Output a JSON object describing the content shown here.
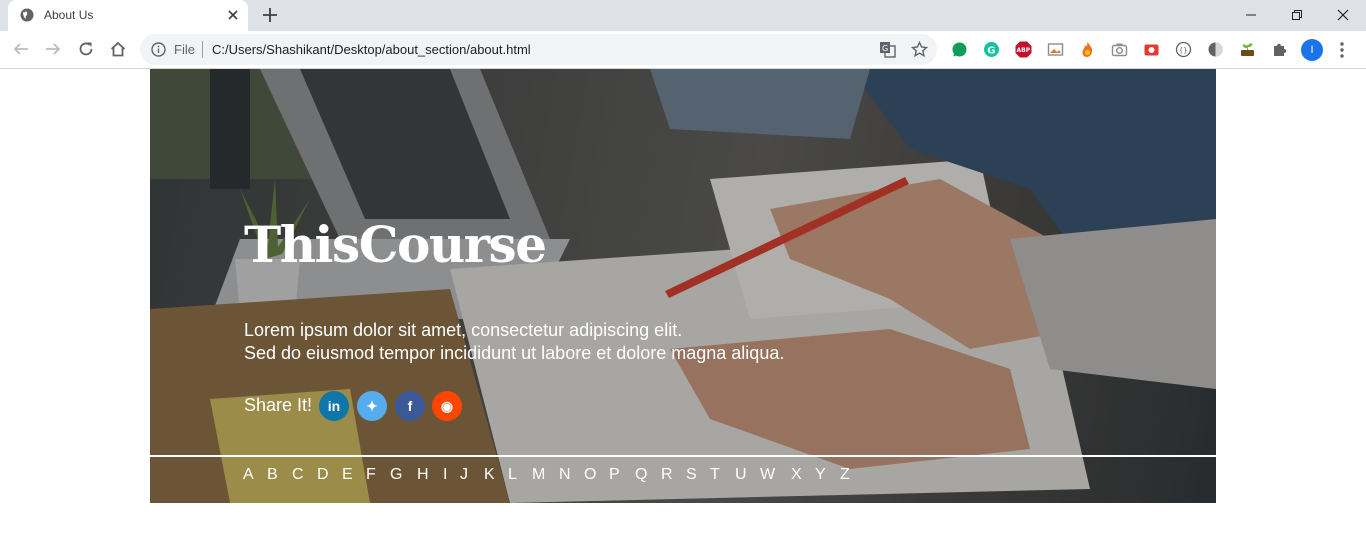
{
  "browser": {
    "tab_title": "About Us",
    "url_scheme": "File",
    "url": "C:/Users/Shashikant/Desktop/about_section/about.html",
    "profile_initial": "I",
    "extensions": [
      "green-circle",
      "grammarly",
      "adblock-plus",
      "gallery",
      "fire",
      "camera",
      "screenshot",
      "code",
      "dark-mode",
      "seedling",
      "puzzle"
    ]
  },
  "hero": {
    "title": "ThisCourse",
    "line1": "Lorem ipsum dolor sit amet, consectetur adipiscing elit.",
    "line2": "Sed do eiusmod tempor incididunt ut labore et dolore magna aliqua.",
    "share_label": "Share It!",
    "social": [
      {
        "name": "linkedin",
        "glyph": "in",
        "color": "#0e76a8"
      },
      {
        "name": "twitter",
        "glyph": "t",
        "color": "#55acee"
      },
      {
        "name": "facebook",
        "glyph": "f",
        "color": "#3b5998"
      },
      {
        "name": "reddit",
        "glyph": "r",
        "color": "#ff4500"
      }
    ]
  },
  "alphabet": [
    "A",
    "B",
    "C",
    "D",
    "E",
    "F",
    "G",
    "H",
    "I",
    "J",
    "K",
    "L",
    "M",
    "N",
    "O",
    "P",
    "Q",
    "R",
    "S",
    "T",
    "U",
    "W",
    "X",
    "Y",
    "Z"
  ]
}
